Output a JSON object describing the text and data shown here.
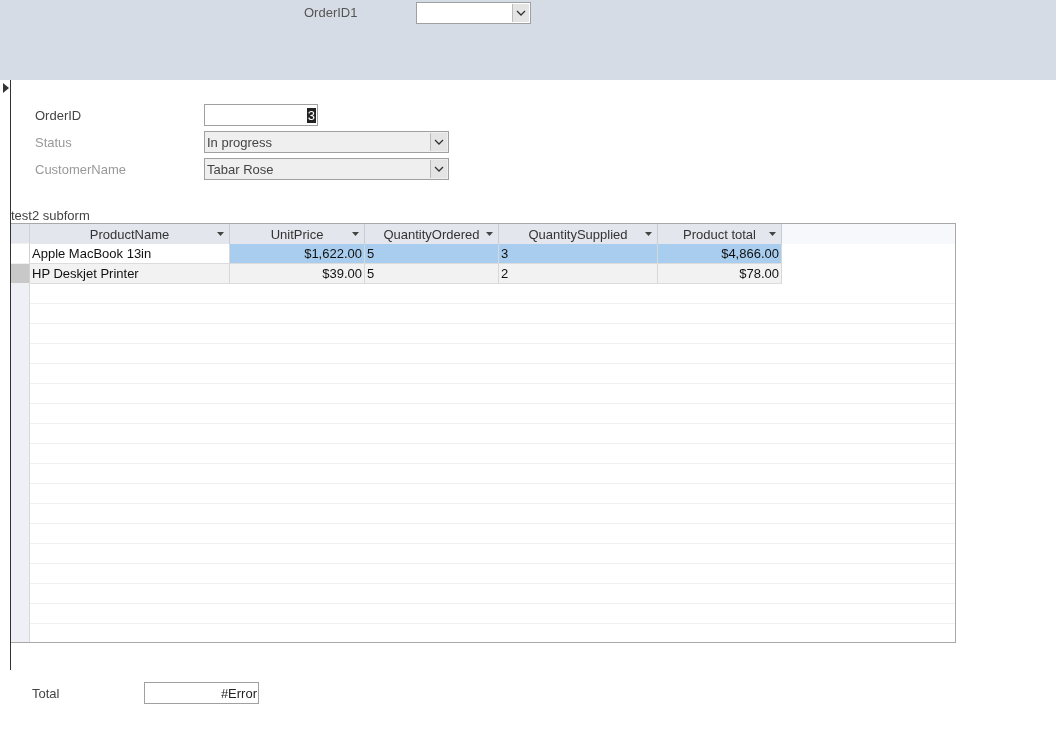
{
  "header": {
    "label": "OrderID1"
  },
  "form": {
    "fields": [
      {
        "label": "OrderID",
        "kind": "textbox",
        "value": "3",
        "disabled": false
      },
      {
        "label": "Status",
        "kind": "combo",
        "value": "In progress",
        "disabled": true
      },
      {
        "label": "CustomerName",
        "kind": "combo",
        "value": "Tabar Rose",
        "disabled": true
      }
    ]
  },
  "subform": {
    "label": "test2 subform",
    "columns": [
      {
        "title": "ProductName",
        "kind": "text"
      },
      {
        "title": "UnitPrice",
        "kind": "currency"
      },
      {
        "title": "QuantityOrdered",
        "kind": "number"
      },
      {
        "title": "QuantitySupplied",
        "kind": "number"
      },
      {
        "title": "Product total",
        "kind": "currency"
      }
    ],
    "rows": [
      {
        "selected": true,
        "cells": [
          "Apple MacBook  13in",
          "$1,622.00",
          "5",
          "3",
          "$4,866.00"
        ]
      },
      {
        "selected": false,
        "cells": [
          "HP Deskjet Printer",
          "$39.00",
          "5",
          "2",
          "$78.00"
        ]
      }
    ]
  },
  "total": {
    "label": "Total",
    "value": "#Error"
  }
}
